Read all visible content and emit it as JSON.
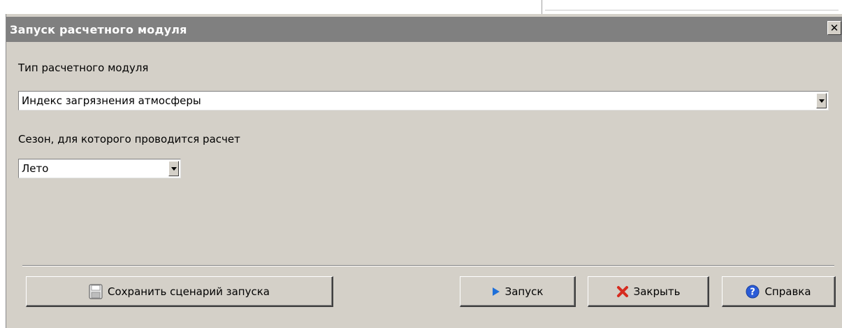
{
  "window": {
    "title": "Запуск расчетного модуля",
    "close_glyph": "✕"
  },
  "module_type": {
    "label": "Тип расчетного модуля",
    "selected": "Индекс загрязнения атмосферы"
  },
  "season": {
    "label": "Сезон, для которого проводится расчет",
    "selected": "Лето"
  },
  "buttons": {
    "save_scenario": {
      "label": "Сохранить сценарий запуска",
      "icon": "floppy-disk-icon"
    },
    "run": {
      "label": "Запуск",
      "icon": "play-icon"
    },
    "close": {
      "label": "Закрыть",
      "icon": "red-x-icon"
    },
    "help": {
      "label": "Справка",
      "icon": "help-icon"
    }
  },
  "colors": {
    "dialog_bg": "#d4d0c8",
    "titlebar_bg": "#808080",
    "play_blue": "#1e6fd9",
    "close_red": "#d62b1f",
    "help_blue": "#2a5bd7"
  }
}
